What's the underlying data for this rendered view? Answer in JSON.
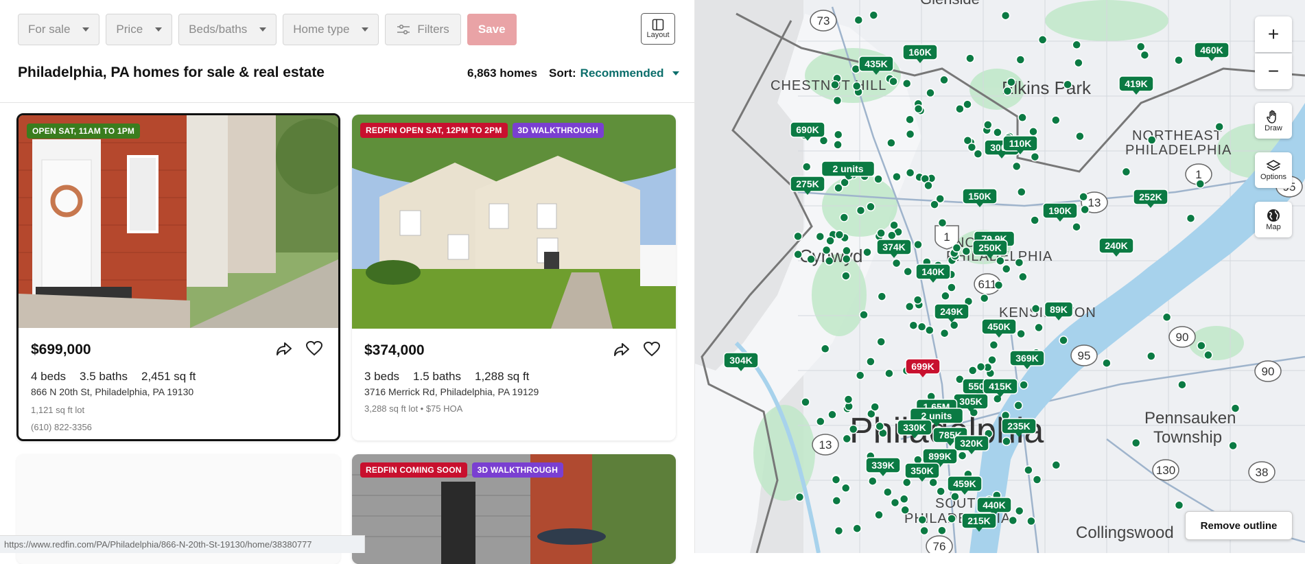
{
  "filters": {
    "for_sale": "For sale",
    "price": "Price",
    "beds_baths": "Beds/baths",
    "home_type": "Home type",
    "filters": "Filters",
    "save": "Save"
  },
  "layout_label": "Layout",
  "page_title": "Philadelphia, PA homes for sale & real estate",
  "home_count": "6,863 homes",
  "sort": {
    "label": "Sort:",
    "value": "Recommended"
  },
  "listings": [
    {
      "badges": [
        {
          "text": "OPEN SAT, 11AM TO 1PM",
          "color": "#3a7d1e"
        }
      ],
      "price": "$699,000",
      "beds": "4 beds",
      "baths": "3.5 baths",
      "sqft": "2,451 sq ft",
      "address": "866 N 20th St, Philadelphia, PA 19130",
      "lot": "1,121 sq ft lot",
      "phone": "(610) 822-3356"
    },
    {
      "badges": [
        {
          "text": "REDFIN OPEN SAT, 12PM TO 2PM",
          "color": "#c8102e"
        },
        {
          "text": "3D WALKTHROUGH",
          "color": "#7a3fd1"
        }
      ],
      "price": "$374,000",
      "beds": "3 beds",
      "baths": "1.5 baths",
      "sqft": "1,288 sq ft",
      "address": "3716 Merrick Rd, Philadelphia, PA 19129",
      "lot": "3,288 sq ft lot • $75 HOA"
    },
    {
      "badges": [
        {
          "text": "REDFIN COMING SOON",
          "color": "#c8102e"
        },
        {
          "text": "3D WALKTHROUGH",
          "color": "#7a3fd1"
        }
      ]
    }
  ],
  "status_url": "https://www.redfin.com/PA/Philadelphia/866-N-20th-St-19130/home/38380777",
  "map": {
    "place_labels": [
      "CHESTNUT HILL",
      "Elkins Park",
      "NORTHEAST",
      "PHILADELPHIA",
      "NORTH",
      "PHILADELPHIA",
      "KENSINGTON",
      "Philadelphia",
      "SOUTH",
      "PHILADELPHIA",
      "Pennsauken",
      "Township",
      "Collingswood",
      "Cynwyd",
      "Glenside"
    ],
    "route_labels": [
      "73",
      "1",
      "13",
      "611",
      "1",
      "95",
      "90",
      "90",
      "130",
      "38",
      "76",
      "13",
      "95"
    ],
    "price_markers": [
      "160K",
      "435K",
      "460K",
      "419K",
      "690K",
      "300K",
      "110K",
      "2 units",
      "275K",
      "150K",
      "190K",
      "252K",
      "374K",
      "79.9K",
      "250K",
      "240K",
      "140K",
      "249K",
      "89K",
      "450K",
      "699K",
      "369K",
      "304K",
      "550K",
      "415K",
      "305K",
      "1.65M",
      "2 units",
      "330K",
      "785K",
      "235K",
      "320K",
      "899K",
      "339K",
      "350K",
      "459K",
      "440K",
      "215K"
    ],
    "controls": {
      "zoom_in": "+",
      "zoom_out": "−",
      "draw": "Draw",
      "options": "Options",
      "map": "Map",
      "remove_outline": "Remove outline"
    }
  },
  "colors": {
    "brand": "#c8102e",
    "accent": "#0b6e6b",
    "marker": "#0b7a43"
  }
}
